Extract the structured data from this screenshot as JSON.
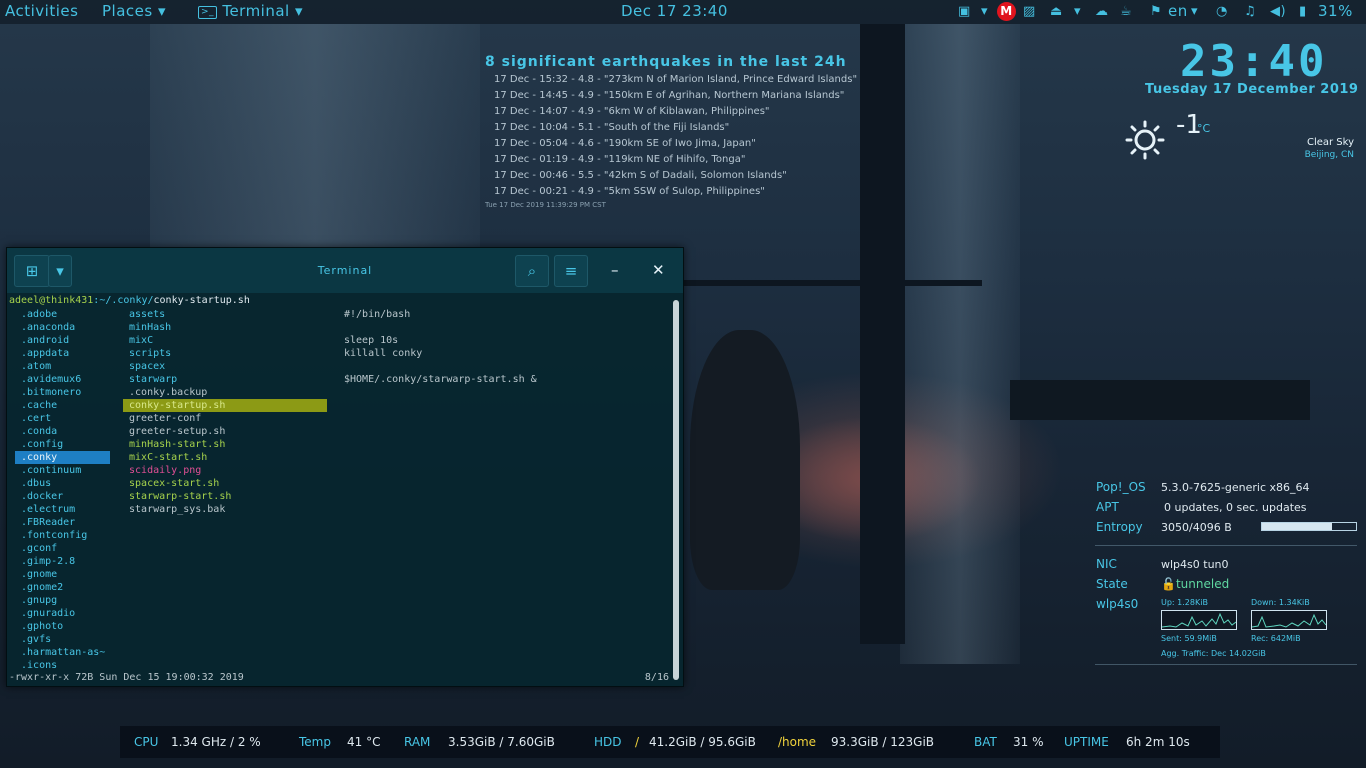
{
  "topbar": {
    "activities": "Activities",
    "places": "Places",
    "terminal": "Terminal",
    "datetime": "Dec 17  23:40",
    "lang": "en",
    "battery": "31%",
    "mega_letter": "M"
  },
  "earthquakes": {
    "title": "8 significant earthquakes in the last 24h",
    "items": [
      "17 Dec - 15:32 - 4.8 - \"273km N of Marion Island, Prince Edward Islands\"",
      "17 Dec - 14:45 - 4.9 - \"150km E of Agrihan, Northern Mariana Islands\"",
      "17 Dec - 14:07 - 4.9 - \"6km W of Kiblawan, Philippines\"",
      "17 Dec - 10:04 - 5.1 - \"South of the Fiji Islands\"",
      "17 Dec - 05:04 - 4.6 - \"190km SE of Iwo Jima, Japan\"",
      "17 Dec - 01:19 - 4.9 - \"119km NE of Hihifo, Tonga\"",
      "17 Dec - 00:46 - 5.5 - \"42km S of Dadali, Solomon Islands\"",
      "17 Dec - 00:21 - 4.9 - \"5km SSW of Sulop, Philippines\""
    ],
    "stamp": "Tue 17 Dec 2019 11:39:29 PM CST"
  },
  "clock": {
    "time": "23:40",
    "date": "Tuesday 17 December 2019"
  },
  "weather": {
    "temp": "-1",
    "unit": "°C",
    "condition": "Clear Sky",
    "city": "Beijing, CN"
  },
  "sysinfo": {
    "os_label": "Pop!_OS",
    "os_value": "5.3.0-7625-generic x86_64",
    "apt_label": "APT",
    "apt_value": "0 updates, 0 sec. updates",
    "entropy_label": "Entropy",
    "entropy_value": "3050/4096 B",
    "entropy_fraction": 0.745,
    "nic_label": "NIC",
    "nic_value": "wlp4s0 tun0",
    "state_label": "State",
    "state_value": "tunneled",
    "iface_label": "wlp4s0",
    "up": "Up: 1.28KiB",
    "down": "Down: 1.34KiB",
    "sent": "Sent: 59.9MiB",
    "rec": "Rec: 642MiB",
    "agg": "Agg. Traffic: Dec 14.02GiB"
  },
  "bottombar": {
    "cpu_k": "CPU",
    "cpu_v": "1.34  GHz / 2  %",
    "temp_k": "Temp",
    "temp_v": "41  °C",
    "ram_k": "RAM",
    "ram_v": "3.53GiB / 7.60GiB",
    "hdd_k": "HDD",
    "hdd_sep": "/",
    "hdd_v": "41.2GiB / 95.6GiB",
    "home_k": "/home",
    "home_v": "93.3GiB / 123GiB",
    "bat_k": "BAT",
    "bat_v": "31  %",
    "uptime_k": "UPTIME",
    "uptime_v": "6h 2m 10s"
  },
  "terminal": {
    "title": "Terminal",
    "prompt_user": "adeel@think431",
    "prompt_path": ":~/.conky/",
    "prompt_file": "conky-startup.sh",
    "col1": [
      ".adobe",
      ".anaconda",
      ".android",
      ".appdata",
      ".atom",
      ".avidemux6",
      ".bitmonero",
      ".cache",
      ".cert",
      ".conda",
      ".config",
      ".conky",
      ".continuum",
      ".dbus",
      ".docker",
      ".electrum",
      ".FBReader",
      ".fontconfig",
      ".gconf",
      ".gimp-2.8",
      ".gnome",
      ".gnome2",
      ".gnupg",
      ".gnuradio",
      ".gphoto",
      ".gvfs",
      ".harmattan-as~",
      ".icons"
    ],
    "col2": [
      {
        "name": "assets",
        "kind": "dir"
      },
      {
        "name": "minHash",
        "kind": "dir"
      },
      {
        "name": "mixC",
        "kind": "dir"
      },
      {
        "name": "scripts",
        "kind": "dir"
      },
      {
        "name": "spacex",
        "kind": "dir"
      },
      {
        "name": "starwarp",
        "kind": "dir"
      },
      {
        "name": ".conky.backup",
        "kind": "file"
      },
      {
        "name": "conky-startup.sh",
        "kind": "sel"
      },
      {
        "name": "greeter-conf",
        "kind": "file"
      },
      {
        "name": "greeter-setup.sh",
        "kind": "file"
      },
      {
        "name": "minHash-start.sh",
        "kind": "exe"
      },
      {
        "name": "mixC-start.sh",
        "kind": "exe"
      },
      {
        "name": "scidaily.png",
        "kind": "png"
      },
      {
        "name": "spacex-start.sh",
        "kind": "exe"
      },
      {
        "name": "starwarp-start.sh",
        "kind": "exe"
      },
      {
        "name": "starwarp_sys.bak",
        "kind": "file"
      }
    ],
    "preview": [
      "#!/bin/bash",
      "",
      "sleep 10s",
      "killall conky",
      "",
      "$HOME/.conky/starwarp-start.sh &"
    ],
    "status_left": "-rwxr-xr-x  72B Sun Dec 15 19:00:32 2019",
    "status_right": "8/16"
  }
}
